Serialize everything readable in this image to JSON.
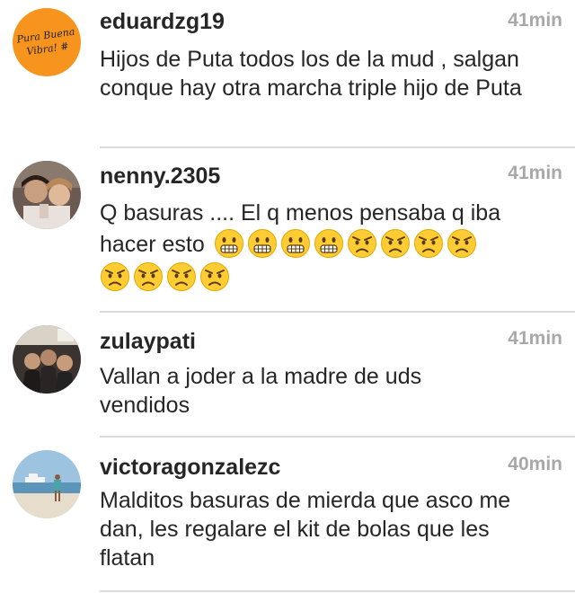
{
  "comments": [
    {
      "username": "eduardzg19",
      "time": "41min",
      "text": "Hijos de Puta todos los de la mud , salgan conque hay otra marcha triple hijo de Puta",
      "avatar_text_1": "Pura Buena",
      "avatar_text_2": "Vibra! #",
      "avatar_color": "#f7941d"
    },
    {
      "username": "nenny.2305",
      "time": "41min",
      "text_line1": "Q basuras .... El q menos pensaba q iba",
      "text_line2": "hacer esto",
      "emojis": [
        "grimacing-face-icon",
        "grimacing-face-icon",
        "grimacing-face-icon",
        "grimacing-face-icon",
        "angry-face-icon",
        "angry-face-icon",
        "angry-face-icon",
        "angry-face-icon",
        "angry-face-icon",
        "angry-face-icon",
        "angry-face-icon",
        "angry-face-icon"
      ]
    },
    {
      "username": "zulaypati",
      "time": "41min",
      "text": "Vallan a joder a la madre de uds vendidos"
    },
    {
      "username": "victoragonzalezc",
      "time": "40min",
      "text": "Malditos basuras de mierda que asco me dan, les regalare el kit de bolas que les flatan"
    }
  ],
  "colors": {
    "text": "#262626",
    "time": "#a8a8a8",
    "divider": "#dbdbdb",
    "emoji_yellow": "#ffcc33"
  }
}
